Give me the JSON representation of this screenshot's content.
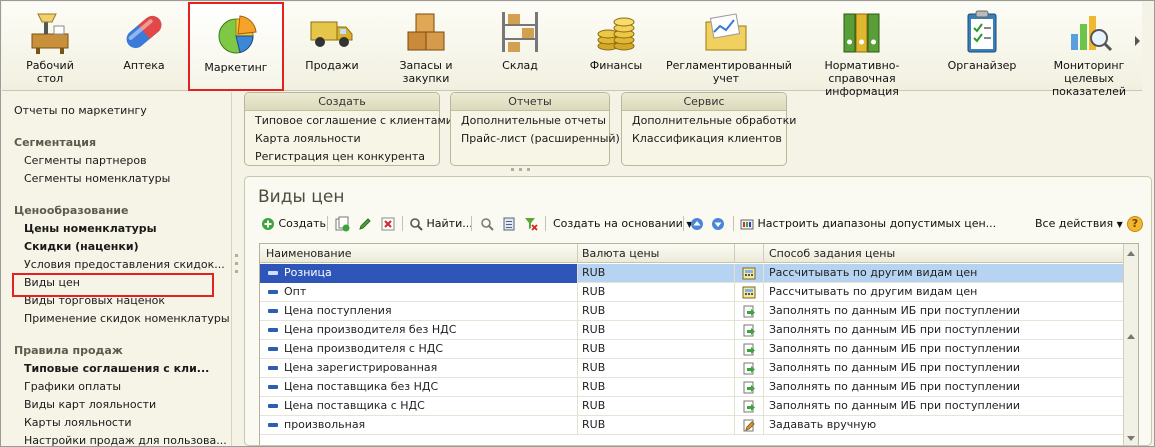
{
  "sections": [
    {
      "label": "Рабочий\nстол",
      "icon": "desktop-icon",
      "selected": false
    },
    {
      "label": "Аптека",
      "icon": "pill-icon",
      "selected": false
    },
    {
      "label": "Маркетинг",
      "icon": "pie-chart-icon",
      "selected": true
    },
    {
      "label": "Продажи",
      "icon": "truck-icon",
      "selected": false
    },
    {
      "label": "Запасы и\nзакупки",
      "icon": "boxes-icon",
      "selected": false
    },
    {
      "label": "Склад",
      "icon": "warehouse-shelf-icon",
      "selected": false
    },
    {
      "label": "Финансы",
      "icon": "coins-icon",
      "selected": false
    },
    {
      "label": "Регламентированный\nучет",
      "icon": "folder-chart-icon",
      "selected": false
    },
    {
      "label": "Нормативно-справочная\nинформация",
      "icon": "binders-icon",
      "selected": false
    },
    {
      "label": "Органайзер",
      "icon": "clipboard-icon",
      "selected": false
    },
    {
      "label": "Мониторинг целевых\nпоказателей",
      "icon": "bar-chart-magnifier-icon",
      "selected": false
    }
  ],
  "nav": {
    "marketing_reports": "Отчеты по маркетингу",
    "segmentation": {
      "title": "Сегментация",
      "items": [
        "Сегменты партнеров",
        "Сегменты номенклатуры"
      ]
    },
    "pricing": {
      "title": "Ценообразование",
      "items": [
        {
          "label": "Цены номенклатуры",
          "bold": true
        },
        {
          "label": "Скидки (наценки)",
          "bold": true
        },
        {
          "label": "Условия предоставления скидок...",
          "bold": false
        },
        {
          "label": "Виды цен",
          "bold": false
        },
        {
          "label": "Виды торговых наценок",
          "bold": false
        },
        {
          "label": "Применение скидок номенклатуры",
          "bold": false
        }
      ]
    },
    "sales_rules": {
      "title": "Правила продаж",
      "items": [
        {
          "label": "Типовые соглашения с кли...",
          "bold": true
        },
        {
          "label": "Графики оплаты",
          "bold": false
        },
        {
          "label": "Виды карт лояльности",
          "bold": false
        },
        {
          "label": "Карты лояльности",
          "bold": false
        },
        {
          "label": "Настройки продаж для пользова...",
          "bold": false
        }
      ]
    }
  },
  "commands": {
    "create": {
      "title": "Создать",
      "items": [
        "Типовое соглашение с клиентами",
        "Карта лояльности",
        "Регистрация цен конкурента"
      ]
    },
    "reports": {
      "title": "Отчеты",
      "items": [
        "Дополнительные отчеты",
        "Прайс-лист (расширенный)"
      ]
    },
    "service": {
      "title": "Сервис",
      "items": [
        "Дополнительные обработки",
        "Классификация клиентов"
      ]
    }
  },
  "list": {
    "title": "Виды цен",
    "toolbar": {
      "create": "Создать",
      "find": "Найти...",
      "create_based_on": "Создать на основании",
      "ranges": "Настроить диапазоны допустимых цен...",
      "all_actions": "Все действия",
      "help": "?"
    },
    "columns": {
      "name": "Наименование",
      "currency": "Валюта цены",
      "icon": "",
      "way": "Способ задания цены"
    },
    "rows": [
      {
        "name": "Розница",
        "currency": "RUB",
        "way": "Рассчитывать по другим видам цен",
        "way_icon": "calc-icon",
        "selected": true
      },
      {
        "name": "Опт",
        "currency": "RUB",
        "way": "Рассчитывать по другим видам цен",
        "way_icon": "calc-icon",
        "selected": false
      },
      {
        "name": "Цена поступления",
        "currency": "RUB",
        "way": "Заполнять по данным ИБ при поступлении",
        "way_icon": "receipt-arrow-icon",
        "selected": false
      },
      {
        "name": "Цена производителя без НДС",
        "currency": "RUB",
        "way": "Заполнять по данным ИБ при поступлении",
        "way_icon": "receipt-arrow-icon",
        "selected": false
      },
      {
        "name": "Цена производителя с НДС",
        "currency": "RUB",
        "way": "Заполнять по данным ИБ при поступлении",
        "way_icon": "receipt-arrow-icon",
        "selected": false
      },
      {
        "name": "Цена зарегистрированная",
        "currency": "RUB",
        "way": "Заполнять по данным ИБ при поступлении",
        "way_icon": "receipt-arrow-icon",
        "selected": false
      },
      {
        "name": "Цена поставщика без НДС",
        "currency": "RUB",
        "way": "Заполнять по данным ИБ при поступлении",
        "way_icon": "receipt-arrow-icon",
        "selected": false
      },
      {
        "name": "Цена поставщика с НДС",
        "currency": "RUB",
        "way": "Заполнять по данным ИБ при поступлении",
        "way_icon": "receipt-arrow-icon",
        "selected": false
      },
      {
        "name": "произвольная",
        "currency": "RUB",
        "way": "Задавать вручную",
        "way_icon": "hand-edit-icon",
        "selected": false
      }
    ]
  },
  "colors": {
    "highlight_red": "#e52020",
    "selection_blue": "#2e56b8",
    "row_selected": "#b7d3f2"
  }
}
